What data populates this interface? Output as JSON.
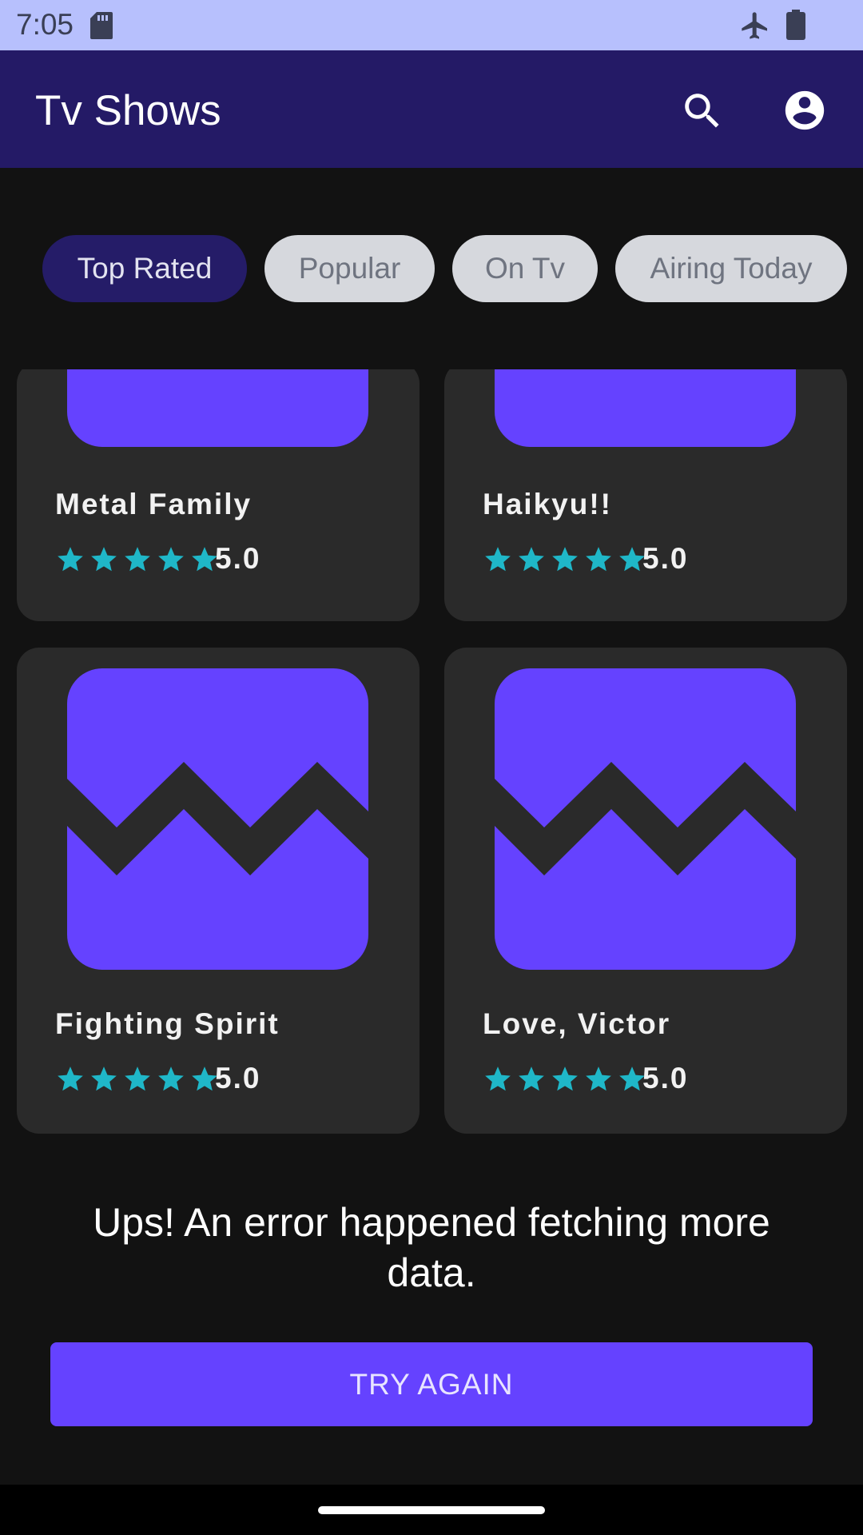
{
  "status_bar": {
    "time": "7:05",
    "icons": [
      "sd-card-icon",
      "airplane-mode-icon",
      "battery-icon"
    ]
  },
  "app_bar": {
    "title": "Tv Shows",
    "icons": [
      "search-icon",
      "account-circle-icon"
    ]
  },
  "tabs": [
    {
      "label": "Top Rated",
      "selected": true
    },
    {
      "label": "Popular",
      "selected": false
    },
    {
      "label": "On Tv",
      "selected": false
    },
    {
      "label": "Airing Today",
      "selected": false
    }
  ],
  "shows": [
    {
      "title": "Metal Family",
      "stars": 5,
      "rating": "5.0"
    },
    {
      "title": "Haikyu!!",
      "stars": 5,
      "rating": "5.0"
    },
    {
      "title": "Fighting Spirit",
      "stars": 5,
      "rating": "5.0"
    },
    {
      "title": "Love, Victor",
      "stars": 5,
      "rating": "5.0"
    }
  ],
  "error": {
    "message": "Ups! An error happened fetching more data.",
    "button_label": "TRY AGAIN"
  },
  "colors": {
    "app_bar": "#241a66",
    "status_bar": "#b7c0fd",
    "accent": "#6542ff",
    "star": "#1fb7c8",
    "card": "#2a2a2a",
    "background": "#121212"
  }
}
